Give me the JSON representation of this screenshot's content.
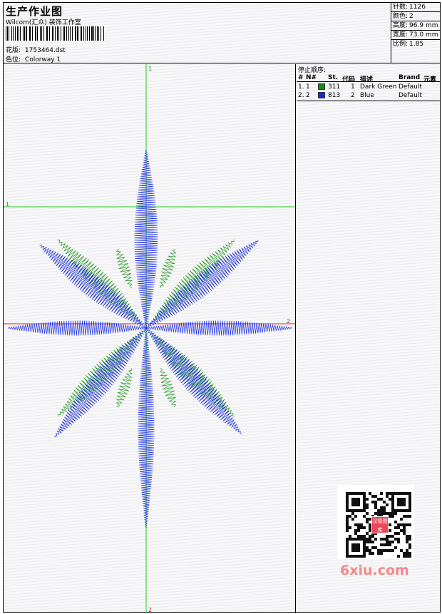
{
  "header": {
    "title": "生产作业图",
    "company": "Wilcom(汇众) 装饰工作室",
    "file_label": "花版:",
    "file_name": "1753464.dst",
    "color_label": "色位:",
    "colorway": "Colorway 1"
  },
  "info": {
    "stitches_label": "针数:",
    "stitches": "1126",
    "colors_label": "颜色:",
    "colors": "2",
    "height_label": "高度:",
    "height": "96.9 mm",
    "width_label": "宽度:",
    "width": "73.0 mm",
    "ratio_label": "比例:",
    "ratio": "1.85"
  },
  "stop_sequence": {
    "title": "停止顺序:",
    "headers": {
      "no": "#",
      "n": "N#",
      "st": "St.",
      "code": "代码",
      "desc": "描述",
      "brand": "Brand",
      "element": "元素"
    },
    "rows": [
      {
        "no": "1.",
        "n": "1",
        "color": "#1a8a1a",
        "st": "311",
        "code": "1",
        "desc": "Dark Green",
        "brand": "Default"
      },
      {
        "no": "2.",
        "n": "2",
        "color": "#1428e0",
        "st": "813",
        "code": "2",
        "desc": "Blue",
        "brand": "Default"
      }
    ]
  },
  "design": {
    "guide_labels": {
      "v_top": "1",
      "h_left": "1",
      "h_right": "2",
      "v_bottom": "2"
    },
    "colors": {
      "green_line": "#22cc22",
      "red_line": "#e02020",
      "thread_green": "#1f9a1f",
      "thread_blue": "#1a2ce6"
    }
  },
  "watermark": {
    "logo_text": "汉德图库",
    "site": "6xiu.com"
  }
}
